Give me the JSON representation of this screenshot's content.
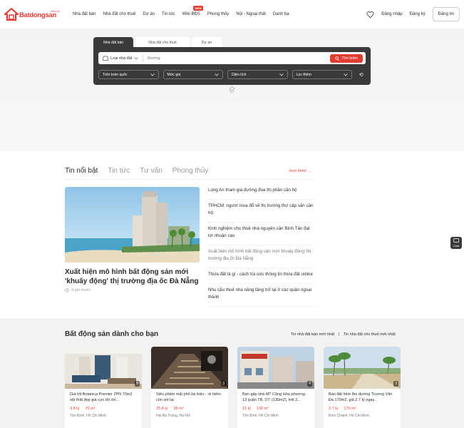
{
  "header": {
    "logo_text": "Batdongsan",
    "logo_sub": ".com.vn",
    "nav": [
      "Nhà đất bán",
      "Nhà đất cho thuê",
      "Dự án",
      "Tin tức",
      "Wiki BĐS",
      "Phong thủy",
      "Nội - Ngoại thất",
      "Danh bạ"
    ],
    "wiki_badge": "NEW",
    "login": "Đăng nhập",
    "register": "Đăng ký",
    "post": "Đăng tin"
  },
  "search": {
    "tabs": [
      "Nhà đất bán",
      "Nhà đất cho thuê",
      "Dự án"
    ],
    "property_type": "Loại nhà đất",
    "placeholder": "Đường",
    "button": "Tìm kiếm",
    "filters": [
      "Trên toàn quốc",
      "Mức giá",
      "Diện tích",
      "Lọc thêm"
    ]
  },
  "news": {
    "tabs": [
      "Tin nổi bật",
      "Tin tức",
      "Tư vấn",
      "Phong thủy"
    ],
    "more": "Xem thêm",
    "featured_title": "Xuất hiện mô hình bất động sản mới 'khuấy động' thị trường địa ốc Đà Nẵng",
    "featured_time": "9 giờ trước",
    "list": [
      "Long An tham gia đường đua thị phần căn hộ",
      "TPHCM: người mua đổ về thị trường thứ cấp săn căn hộ",
      "Kinh nghiệm cho thuê nhà nguyên căn Bình Tân đạt lợi nhuận cao",
      "Xuất hiện mô hình bất động sản mới 'khuấy động' thị trường địa ốc Đà Nẵng",
      "Thừa đất là gì - cách tra cứu thông tin thừa đất online",
      "Nhu cầu thuê nhà nâng tầng trở lại ở các quận ngoại thành"
    ],
    "chat": "Chat"
  },
  "listings": {
    "title": "Bất động sản dành cho bạn",
    "link1": "Tin nhà đất bán mới nhất",
    "separator": "|",
    "link2": "Tin nhà đất cho thuê mới nhất",
    "cards": [
      {
        "title": "Giá tốt Botanica Premier 2PN 70m2 nội thất đẹp giá cực tốt chỉ...",
        "price": "3.8 tỷ",
        "area": "70 m²",
        "location": "Tân Bình, Hồ Chí Minh",
        "images": "5"
      },
      {
        "title": "Siêu phẩm mặt phố bà triệu - rẻ hiếm còn sót lại",
        "price": "25.8 tỷ",
        "area": "36 m²",
        "location": "Hai Bà Trưng, Hà Nội",
        "images": "3"
      },
      {
        "title": "Bán gấp nhà MT Cộng Hòa phường 13 quận TB, DT: (130m2), trệt 2...",
        "price": "21 tỷ",
        "area": "130 m²",
        "location": "Tân Bình, Hồ Chí Minh",
        "images": "4"
      },
      {
        "title": "Bán đất hẻm 8m đường Trương Văn Đa 170m2, giá 2.7 tỷ ngay...",
        "price": "2.7 tỷ",
        "area": "170 m²",
        "location": "Bình Chánh, Hồ Chí Minh",
        "images": "3"
      }
    ]
  },
  "colors": {
    "brand": "#e03c31",
    "dark_panel": "#3a3a3a"
  }
}
